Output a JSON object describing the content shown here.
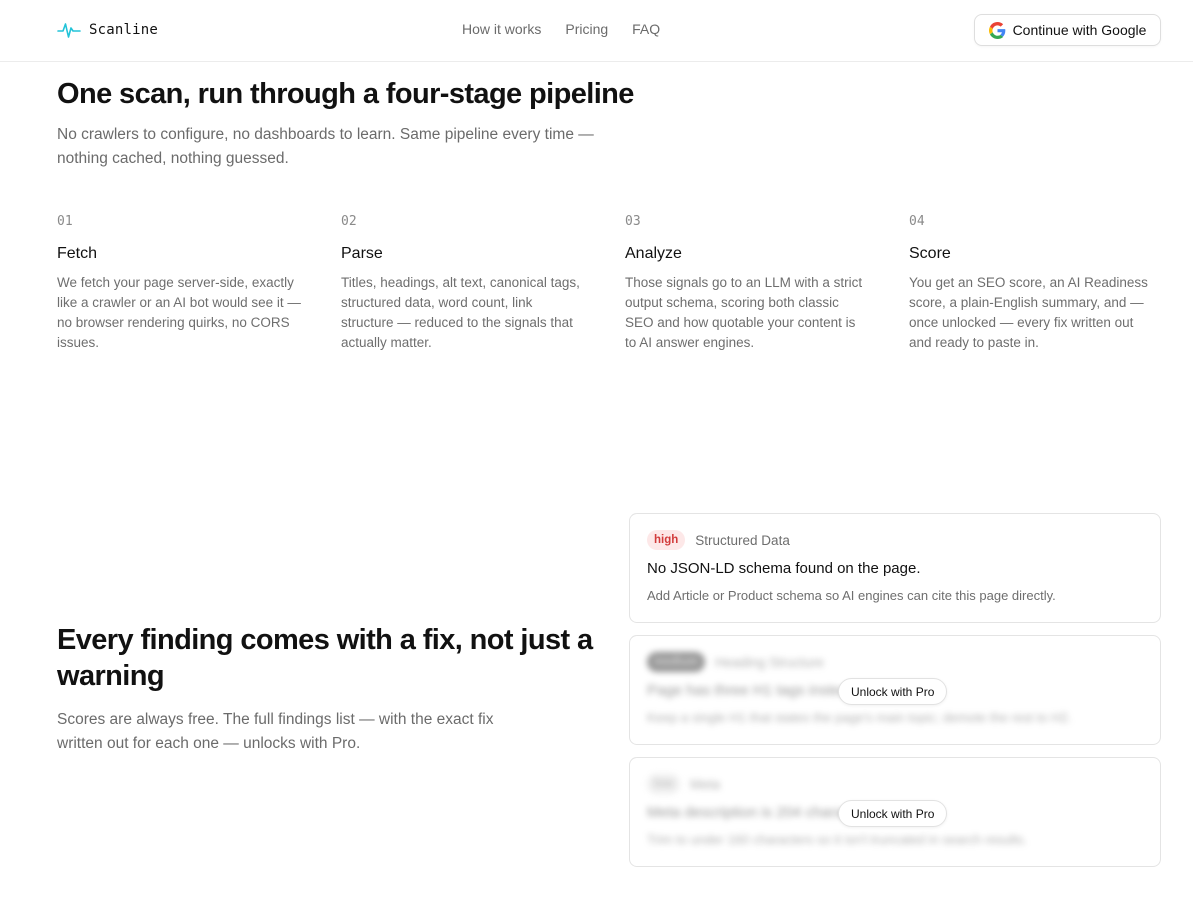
{
  "header": {
    "brand": "Scanline",
    "nav": [
      "How it works",
      "Pricing",
      "FAQ"
    ],
    "google_button": "Continue with Google"
  },
  "pipeline": {
    "title": "One scan, run through a four-stage pipeline",
    "lede": "No crawlers to configure, no dashboards to learn. Same pipeline every time — nothing cached, nothing guessed.",
    "steps": [
      {
        "num": "01",
        "title": "Fetch",
        "desc": "We fetch your page server-side, exactly like a crawler or an AI bot would see it — no browser rendering quirks, no CORS issues."
      },
      {
        "num": "02",
        "title": "Parse",
        "desc": "Titles, headings, alt text, canonical tags, structured data, word count, link structure — reduced to the signals that actually matter."
      },
      {
        "num": "03",
        "title": "Analyze",
        "desc": "Those signals go to an LLM with a strict output schema, scoring both classic SEO and how quotable your content is to AI answer engines."
      },
      {
        "num": "04",
        "title": "Score",
        "desc": "You get an SEO score, an AI Readiness score, a plain-English summary, and — once unlocked — every fix written out and ready to paste in."
      }
    ]
  },
  "findings": {
    "title": "Every finding comes with a fix, not just a warning",
    "lede": "Scores are always free. The full findings list — with the exact fix written out for each one — unlocks with Pro.",
    "cards": [
      {
        "severity": "high",
        "category": "Structured Data",
        "title": "No JSON-LD schema found on the page.",
        "desc": "Add Article or Product schema so AI engines can cite this page directly."
      },
      {
        "severity": "medium",
        "category": "Heading Structure",
        "title": "Page has three H1 tags instead of one.",
        "desc": "Keep a single H1 that states the page's main topic; demote the rest to H2.",
        "unlock": "Unlock with Pro"
      },
      {
        "severity": "low",
        "category": "Meta",
        "title": "Meta description is 204 characters.",
        "desc": "Trim to under 160 characters so it isn't truncated in search results.",
        "unlock": "Unlock with Pro"
      }
    ]
  },
  "colors": {
    "accent": "#22c3d8",
    "high": "#d23b3b"
  }
}
